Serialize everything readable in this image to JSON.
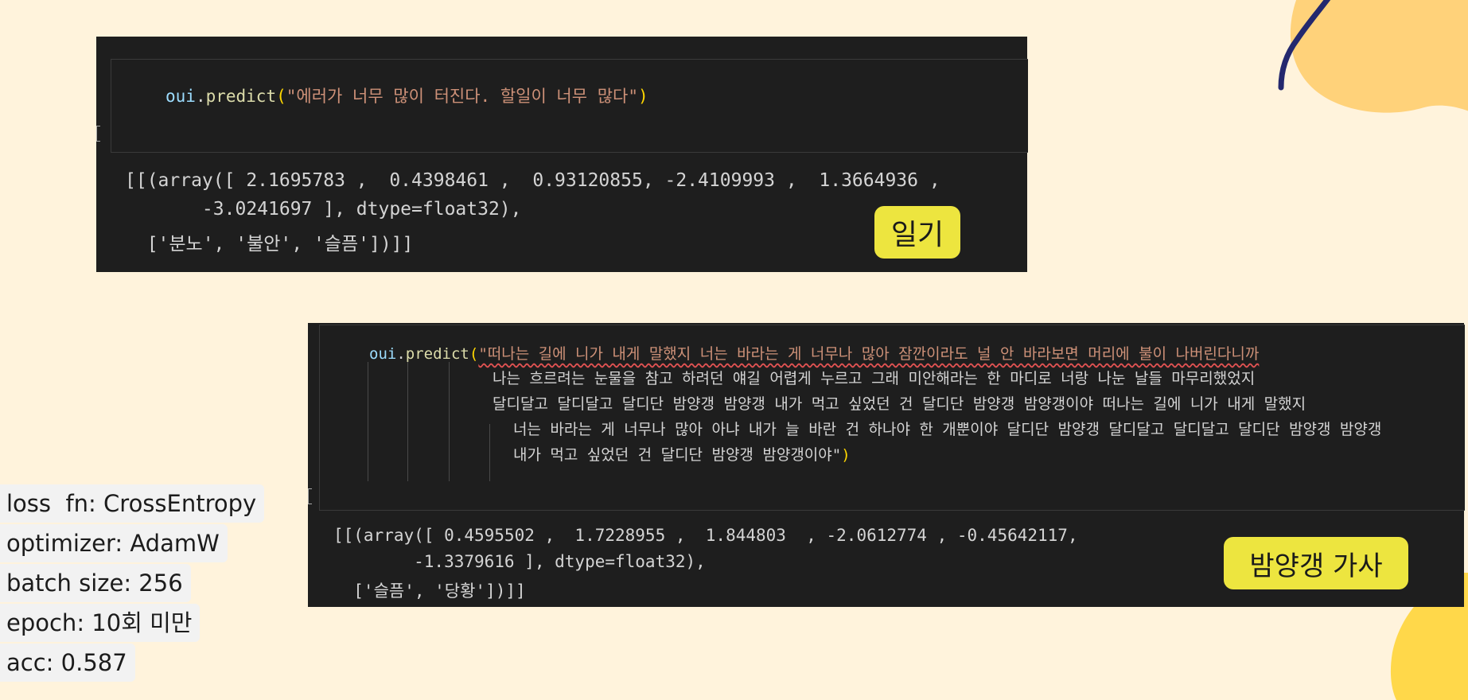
{
  "panel1": {
    "code": {
      "obj": "oui",
      "dot": ".",
      "method": "predict",
      "open": "(",
      "string": "\"에러가 너무 많이 터진다. 할일이 너무 많다\"",
      "close": ")"
    },
    "output": [
      "[[(array([ 2.1695783 ,  0.4398461 ,  0.93120855, -2.4109993 ,  1.3664936 ,",
      "       -3.0241697 ], dtype=float32),",
      "  ['분노', '불안', '슬픔'])]]"
    ],
    "tag": "일기"
  },
  "panel2": {
    "code": {
      "obj": "oui",
      "dot": ".",
      "method": "predict",
      "open": "(",
      "line1": "\"떠나는 길에 니가 내게 말했지 너는 바라는 게 너무나 많아 잠깐이라도 널 안 바라보면 머리에 불이 나버린다니까",
      "line2": "나는 흐르려는 눈물을 참고 하려던 얘길 어렵게 누르고 그래 미안해라는 한 마디로 너랑 나눈 날들 마무리했었지",
      "line3": "달디달고 달디달고 달디단 밤양갱 밤양갱 내가 먹고 싶었던 건 달디단 밤양갱 밤양갱이야 떠나는 길에 니가 내게 말했지",
      "line4": "너는 바라는 게 너무나 많아 아냐 내가 늘 바란 건 하나야 한 개뿐이야 달디단 밤양갱 달디달고 달디달고 달디단 밤양갱 밤양갱",
      "line5": "내가 먹고 싶었던 건 달디단 밤양갱 밤양갱이야\"",
      "close": ")"
    },
    "output": [
      "[[(array([ 0.4595502 ,  1.7228955 ,  1.844803  , -2.0612774 , -0.45642117,",
      "        -1.3379616 ], dtype=float32),",
      "  ['슬픔', '당황'])]]"
    ],
    "tag": "밤양갱 가사"
  },
  "hyperparams": [
    "loss  fn: CrossEntropy",
    "optimizer: AdamW",
    "batch size: 256",
    "epoch: 10회 미만",
    "acc: 0.587"
  ],
  "colors": {
    "background": "#fff3dc",
    "blob": "#ffd27a",
    "blob_bottom": "#ffd84a",
    "line": "#24286e",
    "tag": "#ede53f"
  }
}
